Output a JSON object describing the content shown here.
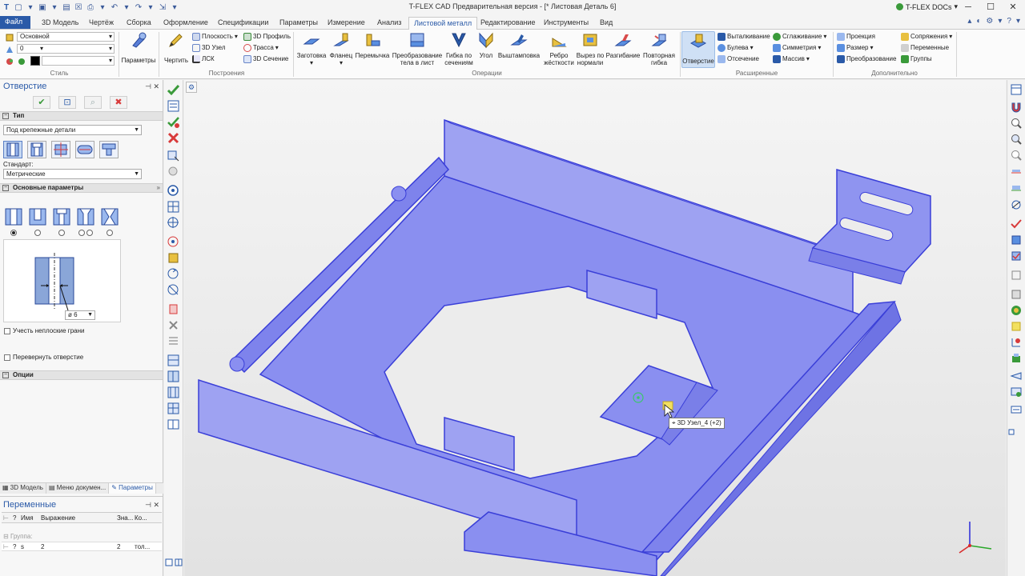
{
  "app": {
    "title": "T-FLEX CAD Предварительная версия - [* Листовая Деталь 6]",
    "docs_label": "T-FLEX DOCs"
  },
  "ribbon_tabs": [
    {
      "label": "Файл"
    },
    {
      "label": "3D Модель"
    },
    {
      "label": "Чертёж"
    },
    {
      "label": "Сборка"
    },
    {
      "label": "Оформление"
    },
    {
      "label": "Спецификации"
    },
    {
      "label": "Параметры"
    },
    {
      "label": "Измерение"
    },
    {
      "label": "Анализ"
    },
    {
      "label": "Листовой металл"
    },
    {
      "label": "Редактирование"
    },
    {
      "label": "Инструменты"
    },
    {
      "label": "Вид"
    }
  ],
  "ribbon": {
    "style": {
      "layer_value": "Основной",
      "level_value": "0",
      "group_label": "Стиль"
    },
    "params_label": "Параметры",
    "draw_label": "Чертить",
    "construct": {
      "plane": "Плоскость",
      "node3d": "3D Узел",
      "lsk": "ЛСК",
      "profile3d": "3D Профиль",
      "path": "Трасса",
      "section3d": "3D Сечение",
      "group_label": "Построения"
    },
    "operations": {
      "blank": "Заготовка",
      "flange": "Фланец",
      "jumper": "Перемычка",
      "transform_l1": "Преобразование",
      "transform_l2": "тела в лист",
      "bend_l1": "Гибка по",
      "bend_l2": "сечениям",
      "corner": "Угол",
      "stamp": "Выштамповка",
      "rib_l1": "Ребро",
      "rib_l2": "жёсткости",
      "cut_l1": "Вырез по",
      "cut_l2": "нормали",
      "unbend": "Разгибание",
      "rebend_l1": "Повторная",
      "rebend_l2": "гибка",
      "group_label": "Операции"
    },
    "extended": {
      "hole": "Отверстие",
      "extrude": "Выталкивание",
      "boolean": "Булева",
      "cut_off": "Отсечение",
      "smooth": "Сглаживание",
      "symmetry": "Симметрия",
      "array": "Массив",
      "group_label": "Расширенные"
    },
    "additional": {
      "projection": "Проекция",
      "size": "Размер",
      "transform": "Преобразование",
      "mates": "Сопряжения",
      "variables": "Переменные",
      "groups": "Группы",
      "group_label": "Дополнительно"
    }
  },
  "panel": {
    "title": "Отверстие",
    "type_section": "Тип",
    "type_value": "Под крепежные детали",
    "standard_label": "Стандарт:",
    "standard_value": "Метрические",
    "main_params_section": "Основные параметры",
    "diameter_value": "ø 6",
    "option_nonplanar": "Учесть неплоские грани",
    "option_flip": "Перевернуть отверстие",
    "options_section": "Опции"
  },
  "bottom_tabs": [
    {
      "label": "3D Модель"
    },
    {
      "label": "Меню докумен..."
    },
    {
      "label": "Параметры"
    }
  ],
  "variables": {
    "title": "Переменные",
    "columns": [
      "Имя",
      "Выражение",
      "Зна...",
      "Ко..."
    ],
    "group_label": "Группа:",
    "rows": [
      {
        "flag": "?",
        "name": "s",
        "expression": "2",
        "value": "2",
        "comment": "тол..."
      }
    ]
  },
  "viewport": {
    "tooltip": "3D Узел_4 (+2)"
  },
  "colors": {
    "accent": "#2a5aa8",
    "part_fill": "#8a8ff0",
    "part_edge": "#3a3fd8",
    "background": "#ececec"
  }
}
